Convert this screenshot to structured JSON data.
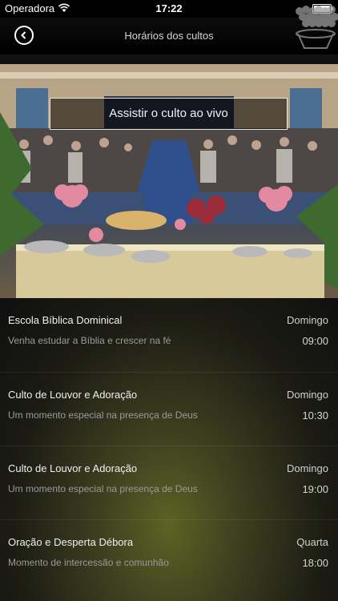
{
  "status_bar": {
    "carrier": "Operadora",
    "time": "17:22"
  },
  "nav": {
    "title": "Horários dos cultos"
  },
  "hero": {
    "live_button_label": "Assistir o culto ao vivo"
  },
  "schedule": [
    {
      "title": "Escola Bíblica Dominical",
      "day": "Domingo",
      "description": "Venha estudar a Bíblia e crescer na fé",
      "time": "09:00"
    },
    {
      "title": "Culto de Louvor e Adoração",
      "day": "Domingo",
      "description": "Um momento especial na presença de Deus",
      "time": "10:30"
    },
    {
      "title": "Culto de Louvor e Adoração",
      "day": "Domingo",
      "description": "Um momento especial na presença de Deus",
      "time": "19:00"
    },
    {
      "title": "Oração e Desperta Débora",
      "day": "Quarta",
      "description": "Momento de intercessão e comunhão",
      "time": "18:00"
    }
  ]
}
